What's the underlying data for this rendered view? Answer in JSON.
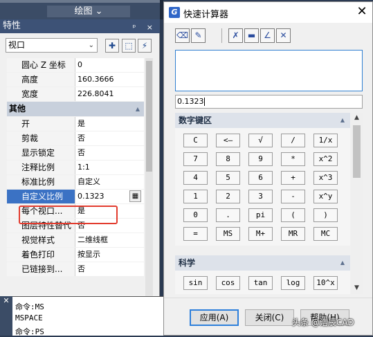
{
  "ribbon": {
    "label": "绘图 ⌄"
  },
  "palette": {
    "title": "特性",
    "title_buttons": "ᵖ ×",
    "object_select": "视口",
    "rows": [
      {
        "label": "圆心 Z 坐标",
        "value": "0"
      },
      {
        "label": "高度",
        "value": "160.3666"
      },
      {
        "label": "宽度",
        "value": "226.8041"
      }
    ],
    "category_other": "其他",
    "other_rows": [
      {
        "label": "开",
        "value": "是"
      },
      {
        "label": "剪裁",
        "value": "否"
      },
      {
        "label": "显示锁定",
        "value": "否"
      },
      {
        "label": "注释比例",
        "value": "1:1"
      },
      {
        "label": "标准比例",
        "value": "自定义"
      },
      {
        "label": "自定义比例",
        "value": "0.1323"
      },
      {
        "label": "每个视口...",
        "value": "是"
      },
      {
        "label": "图层特性替代",
        "value": "否"
      },
      {
        "label": "视觉样式",
        "value": "二维线框"
      },
      {
        "label": "着色打印",
        "value": "按显示"
      },
      {
        "label": "已链接到...",
        "value": "否"
      }
    ]
  },
  "command": {
    "lines": [
      "命令:MS",
      "MSPACE",
      "命令:PS"
    ]
  },
  "calculator": {
    "title": "快速计算器",
    "entry_value": "0.1323",
    "numpad_title": "数字键区",
    "numpad_keys": [
      [
        "C",
        "<—",
        "√",
        "/",
        "1/x"
      ],
      [
        "7",
        "8",
        "9",
        "*",
        "x^2"
      ],
      [
        "4",
        "5",
        "6",
        "+",
        "x^3"
      ],
      [
        "1",
        "2",
        "3",
        "-",
        "x^y"
      ],
      [
        "0",
        ".",
        "pi",
        "(",
        ")"
      ],
      [
        "=",
        "MS",
        "M+",
        "MR",
        "MC"
      ]
    ],
    "science_title": "科学",
    "science_keys": [
      "sin",
      "cos",
      "tan",
      "log",
      "10^x"
    ],
    "buttons": {
      "apply": "应用(A)",
      "close": "关闭(C)",
      "help": "帮助(H)"
    }
  },
  "watermark": "头条 @浩辰CAD"
}
